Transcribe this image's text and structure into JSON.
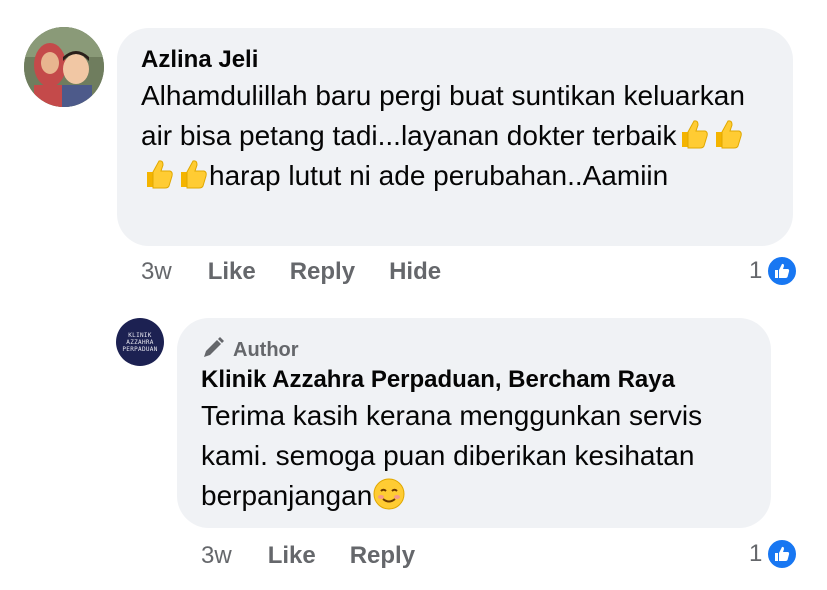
{
  "comment": {
    "author_name": "Azlina Jeli",
    "text_parts": [
      "Alhamdulillah baru pergi buat suntikan keluarkan air bisa petang tadi...layanan dokter terbaik",
      "harap lutut ni ade perubahan..Aamiin"
    ],
    "emoji_icons": [
      "thumbs-up-emoji",
      "thumbs-up-emoji",
      "thumbs-up-emoji",
      "thumbs-up-emoji"
    ],
    "time": "3w",
    "actions": {
      "like": "Like",
      "reply": "Reply",
      "hide": "Hide"
    },
    "reaction_count": "1"
  },
  "reply": {
    "badge_label": "Author",
    "author_name": "Klinik Azzahra Perpaduan, Bercham Raya",
    "text": "Terima kasih kerana menggunkan servis kami. semoga puan diberikan kesihatan berpanjangan",
    "emoji_icon": "smiling-face-emoji",
    "time": "3w",
    "actions": {
      "like": "Like",
      "reply": "Reply"
    },
    "reaction_count": "1",
    "avatar_logo_lines": [
      "KLINIK AZZAHRA",
      "PERPADUAN"
    ]
  },
  "colors": {
    "bubble": "#f0f2f5",
    "like_blue": "#1877f2",
    "secondary_text": "#65676b",
    "clinic_avatar": "#1c2152"
  }
}
